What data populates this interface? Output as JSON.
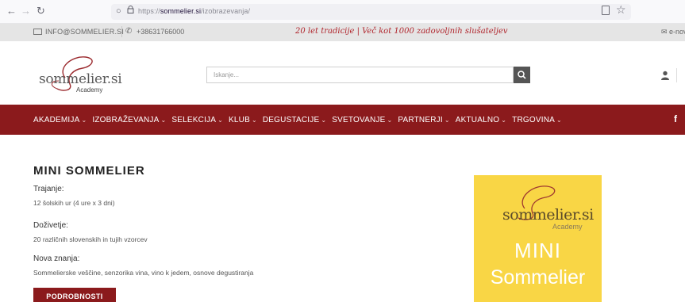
{
  "browser": {
    "url_prefix": "https://",
    "url_domain": "sommelier.si",
    "url_path": "/izobrazevanja/"
  },
  "topbar": {
    "email": "INFO@SOMMELIER.SI",
    "phone": "+38631766000",
    "tagline": "20 let tradicije | Več kot 1000 zadovoljnih slušateljev",
    "right_email": "e-nov"
  },
  "header": {
    "logo_name": "sommelier.si",
    "logo_sub": "Academy",
    "search_placeholder": "Iskanje..."
  },
  "nav": {
    "items": [
      {
        "label": "AKADEMIJA",
        "active": false
      },
      {
        "label": "IZOBRAŽEVANJA",
        "active": true
      },
      {
        "label": "SELEKCIJA",
        "active": false
      },
      {
        "label": "KLUB",
        "active": false
      },
      {
        "label": "DEGUSTACIJE",
        "active": false
      },
      {
        "label": "SVETOVANJE",
        "active": false
      },
      {
        "label": "PARTNERJI",
        "active": false
      },
      {
        "label": "AKTUALNO",
        "active": false
      },
      {
        "label": "TRGOVINA",
        "active": false
      }
    ],
    "facebook": "f"
  },
  "course": {
    "title": "MINI SOMMELIER",
    "duration_label": "Trajanje:",
    "duration_value": "12 šolskih ur (4 ure x 3 dni)",
    "experience_label": "Doživetje:",
    "experience_value": "20 različnih slovenskih in tujih vzorcev",
    "skills_label": "Nova znanja:",
    "skills_value": "Sommelierske veščine, senzorika vina, vino k jedem, osnove degustiranja",
    "button": "PODROBNOSTI"
  },
  "promo": {
    "logo_name": "sommelier.si",
    "logo_sub": "Academy",
    "line1": "MINI",
    "line2": "Sommelier"
  },
  "colors": {
    "brand_red": "#8b1a1c",
    "promo_yellow": "#f9d645",
    "topbar_bg": "#e5e5e5"
  }
}
